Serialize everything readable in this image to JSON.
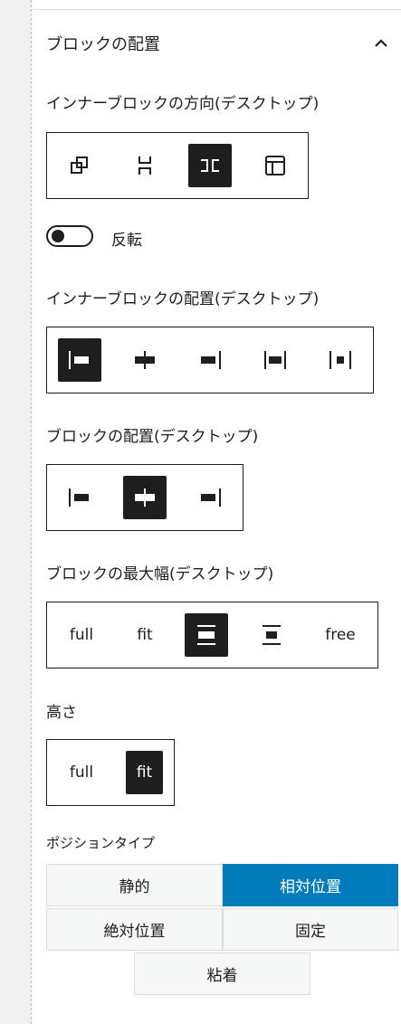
{
  "panel": {
    "title": "ブロックの配置",
    "collapse_icon": "chevron-up-icon"
  },
  "inner_direction": {
    "label": "インナーブロックの方向(デスクトップ)",
    "options": [
      {
        "icon": "overlap-icon",
        "selected": false
      },
      {
        "icon": "stack-vertical-icon",
        "selected": false
      },
      {
        "icon": "stack-horizontal-icon",
        "selected": true
      },
      {
        "icon": "layout-grid-icon",
        "selected": false
      }
    ]
  },
  "reverse_toggle": {
    "label": "反転",
    "on": false
  },
  "inner_alignment": {
    "label": "インナーブロックの配置(デスクトップ)",
    "options": [
      {
        "icon": "justify-left-icon",
        "selected": true
      },
      {
        "icon": "justify-center-icon",
        "selected": false
      },
      {
        "icon": "justify-right-icon",
        "selected": false
      },
      {
        "icon": "justify-space-between-icon",
        "selected": false
      },
      {
        "icon": "justify-space-around-icon",
        "selected": false
      }
    ]
  },
  "block_alignment": {
    "label": "ブロックの配置(デスクトップ)",
    "options": [
      {
        "icon": "justify-left-icon",
        "selected": false
      },
      {
        "icon": "justify-center-icon",
        "selected": true
      },
      {
        "icon": "justify-right-icon",
        "selected": false
      }
    ]
  },
  "max_width": {
    "label": "ブロックの最大幅(デスクトップ)",
    "options": [
      {
        "text": "full",
        "selected": false
      },
      {
        "text": "fit",
        "selected": false
      },
      {
        "icon": "width-narrow-icon",
        "selected": true
      },
      {
        "icon": "width-wide-icon",
        "selected": false
      },
      {
        "text": "free",
        "selected": false
      }
    ]
  },
  "height": {
    "label": "高さ",
    "options": [
      {
        "text": "full",
        "selected": false
      },
      {
        "text": "fit",
        "selected": true
      }
    ]
  },
  "position_type": {
    "label": "ポジションタイプ",
    "options": [
      {
        "text": "静的",
        "selected": false
      },
      {
        "text": "相対位置",
        "selected": true
      },
      {
        "text": "絶対位置",
        "selected": false
      },
      {
        "text": "固定",
        "selected": false
      },
      {
        "text": "粘着",
        "selected": false
      }
    ]
  },
  "colors": {
    "accent": "#007cba",
    "dark": "#1e1e1e"
  }
}
